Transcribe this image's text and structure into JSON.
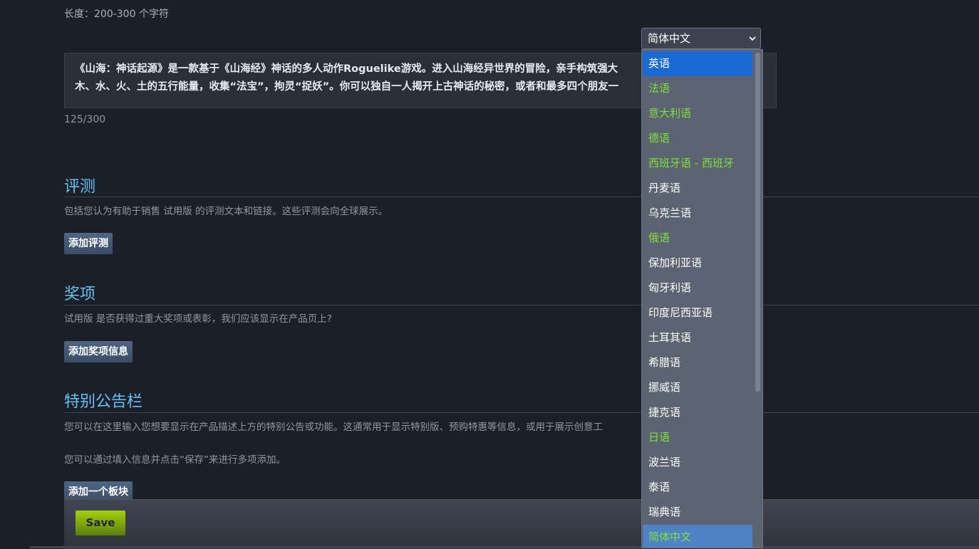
{
  "length_hint": "长度：200-300 个字符",
  "description": {
    "line1": "《山海：神话起源》是一款基于《山海经》神话的多人动作Roguelike游戏。进入山海经异世界的冒险，亲手构筑强大",
    "line2": "木、水、火、土的五行能量，收集“法宝”，拘灵“捉妖”。你可以独自一人揭开上古神话的秘密，或者和最多四个朋友一",
    "counter": "125/300"
  },
  "reviews": {
    "title": "评测",
    "desc": "包括您认为有助于销售 试用版 的评测文本和链接。这些评测会向全球展示。",
    "button": "添加评测"
  },
  "awards": {
    "title": "奖项",
    "desc": "试用版 是否获得过重大奖项或表彰，我们应该显示在产品页上?",
    "button": "添加奖项信息"
  },
  "announcement": {
    "title": "特别公告栏",
    "desc1": "您可以在这里输入您想要显示在产品描述上方的特别公告或功能。这通常用于显示特别版、预购特惠等信息，或用于展示创意工",
    "desc2": "您可以通过填入信息并点击“保存”来进行多项添加。",
    "button": "添加一个板块"
  },
  "save_label": "Save",
  "language_select": {
    "selected": "简体中文",
    "icon": "chevron-down-icon",
    "colors": {
      "highlight_bg": "#1a6ad3",
      "selected_bg": "#4e82c4",
      "supported_text": "#7ee03d",
      "plain_text": "#ffffff"
    },
    "options": [
      {
        "label": "英语",
        "state": "highlighted"
      },
      {
        "label": "法语",
        "state": "supported"
      },
      {
        "label": "意大利语",
        "state": "supported"
      },
      {
        "label": "德语",
        "state": "supported"
      },
      {
        "label": "西班牙语 - 西班牙",
        "state": "supported"
      },
      {
        "label": "丹麦语",
        "state": "plain"
      },
      {
        "label": "乌克兰语",
        "state": "plain"
      },
      {
        "label": "俄语",
        "state": "supported"
      },
      {
        "label": "保加利亚语",
        "state": "plain"
      },
      {
        "label": "匈牙利语",
        "state": "plain"
      },
      {
        "label": "印度尼西亚语",
        "state": "plain"
      },
      {
        "label": "土耳其语",
        "state": "plain"
      },
      {
        "label": "希腊语",
        "state": "plain"
      },
      {
        "label": "挪威语",
        "state": "plain"
      },
      {
        "label": "捷克语",
        "state": "plain"
      },
      {
        "label": "日语",
        "state": "supported"
      },
      {
        "label": "波兰语",
        "state": "plain"
      },
      {
        "label": "泰语",
        "state": "plain"
      },
      {
        "label": "瑞典语",
        "state": "plain"
      },
      {
        "label": "简体中文",
        "state": "selected"
      }
    ]
  }
}
